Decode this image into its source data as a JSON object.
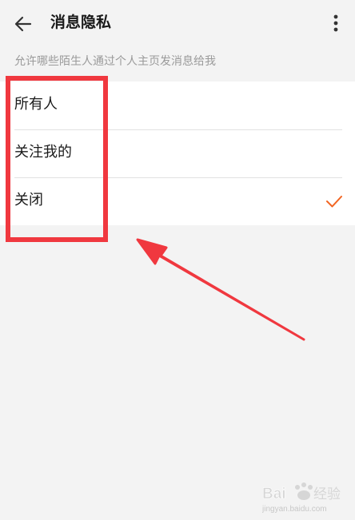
{
  "header": {
    "back_icon": "arrow-left-icon",
    "title": "消息隐私",
    "more_icon": "more-vertical-icon"
  },
  "subtitle": "允许哪些陌生人通过个人主页发消息给我",
  "options": [
    {
      "label": "所有人",
      "selected": false
    },
    {
      "label": "关注我的",
      "selected": false
    },
    {
      "label": "关闭",
      "selected": true
    }
  ],
  "colors": {
    "background": "#f3f3f3",
    "card": "#ffffff",
    "accent": "#f26522",
    "annotation": "#f0383f",
    "subtitle": "#9a9a9a"
  },
  "watermark": {
    "text": "Bai 经验",
    "url": "jingyan.baidu.com"
  }
}
